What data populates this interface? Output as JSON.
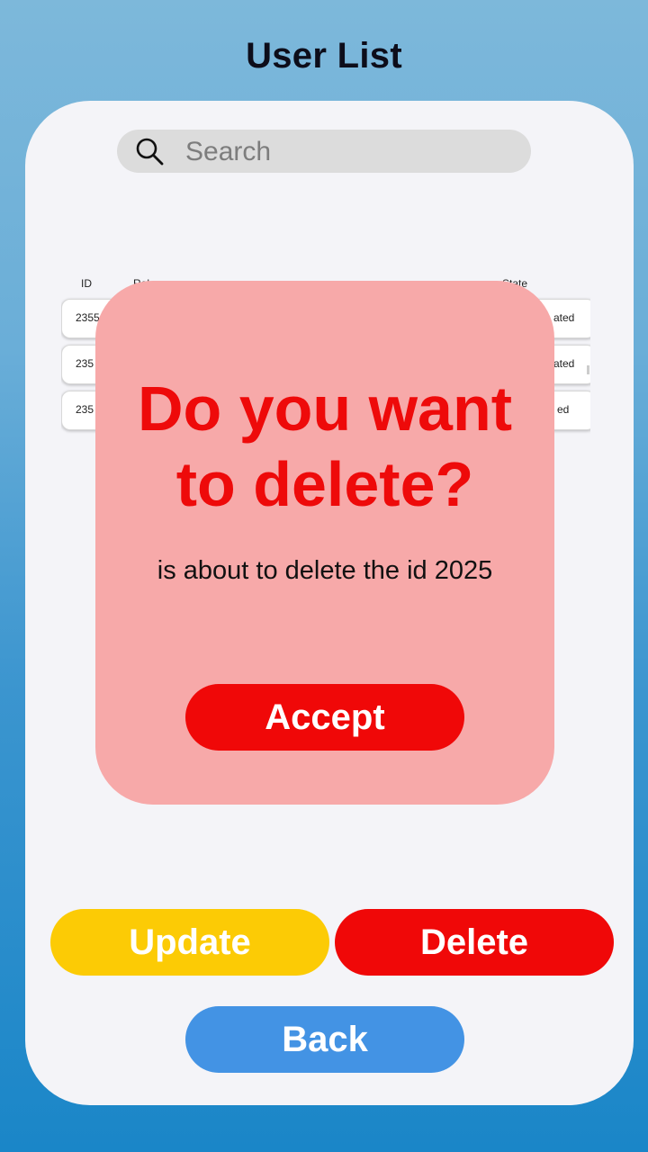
{
  "header": {
    "title": "User List"
  },
  "search": {
    "placeholder": "Search",
    "value": ""
  },
  "table": {
    "columns": [
      "ID",
      "Rol",
      "State"
    ],
    "rows": [
      {
        "id": "2355",
        "state": "ated"
      },
      {
        "id": "235",
        "state": "ated"
      },
      {
        "id": "235",
        "state": "ed"
      }
    ]
  },
  "actions": {
    "update_label": "Update",
    "delete_label": "Delete",
    "back_label": "Back"
  },
  "modal": {
    "heading_line1": "Do you want",
    "heading_line2": "to delete?",
    "message": "is about to delete the id 2025",
    "accept_label": "Accept"
  },
  "colors": {
    "update": "#fccb05",
    "delete": "#f00808",
    "back": "#4393e4",
    "modal_bg": "#f7a9a9",
    "modal_heading": "#ee0a0a"
  },
  "icons": {
    "search": "search-icon"
  }
}
